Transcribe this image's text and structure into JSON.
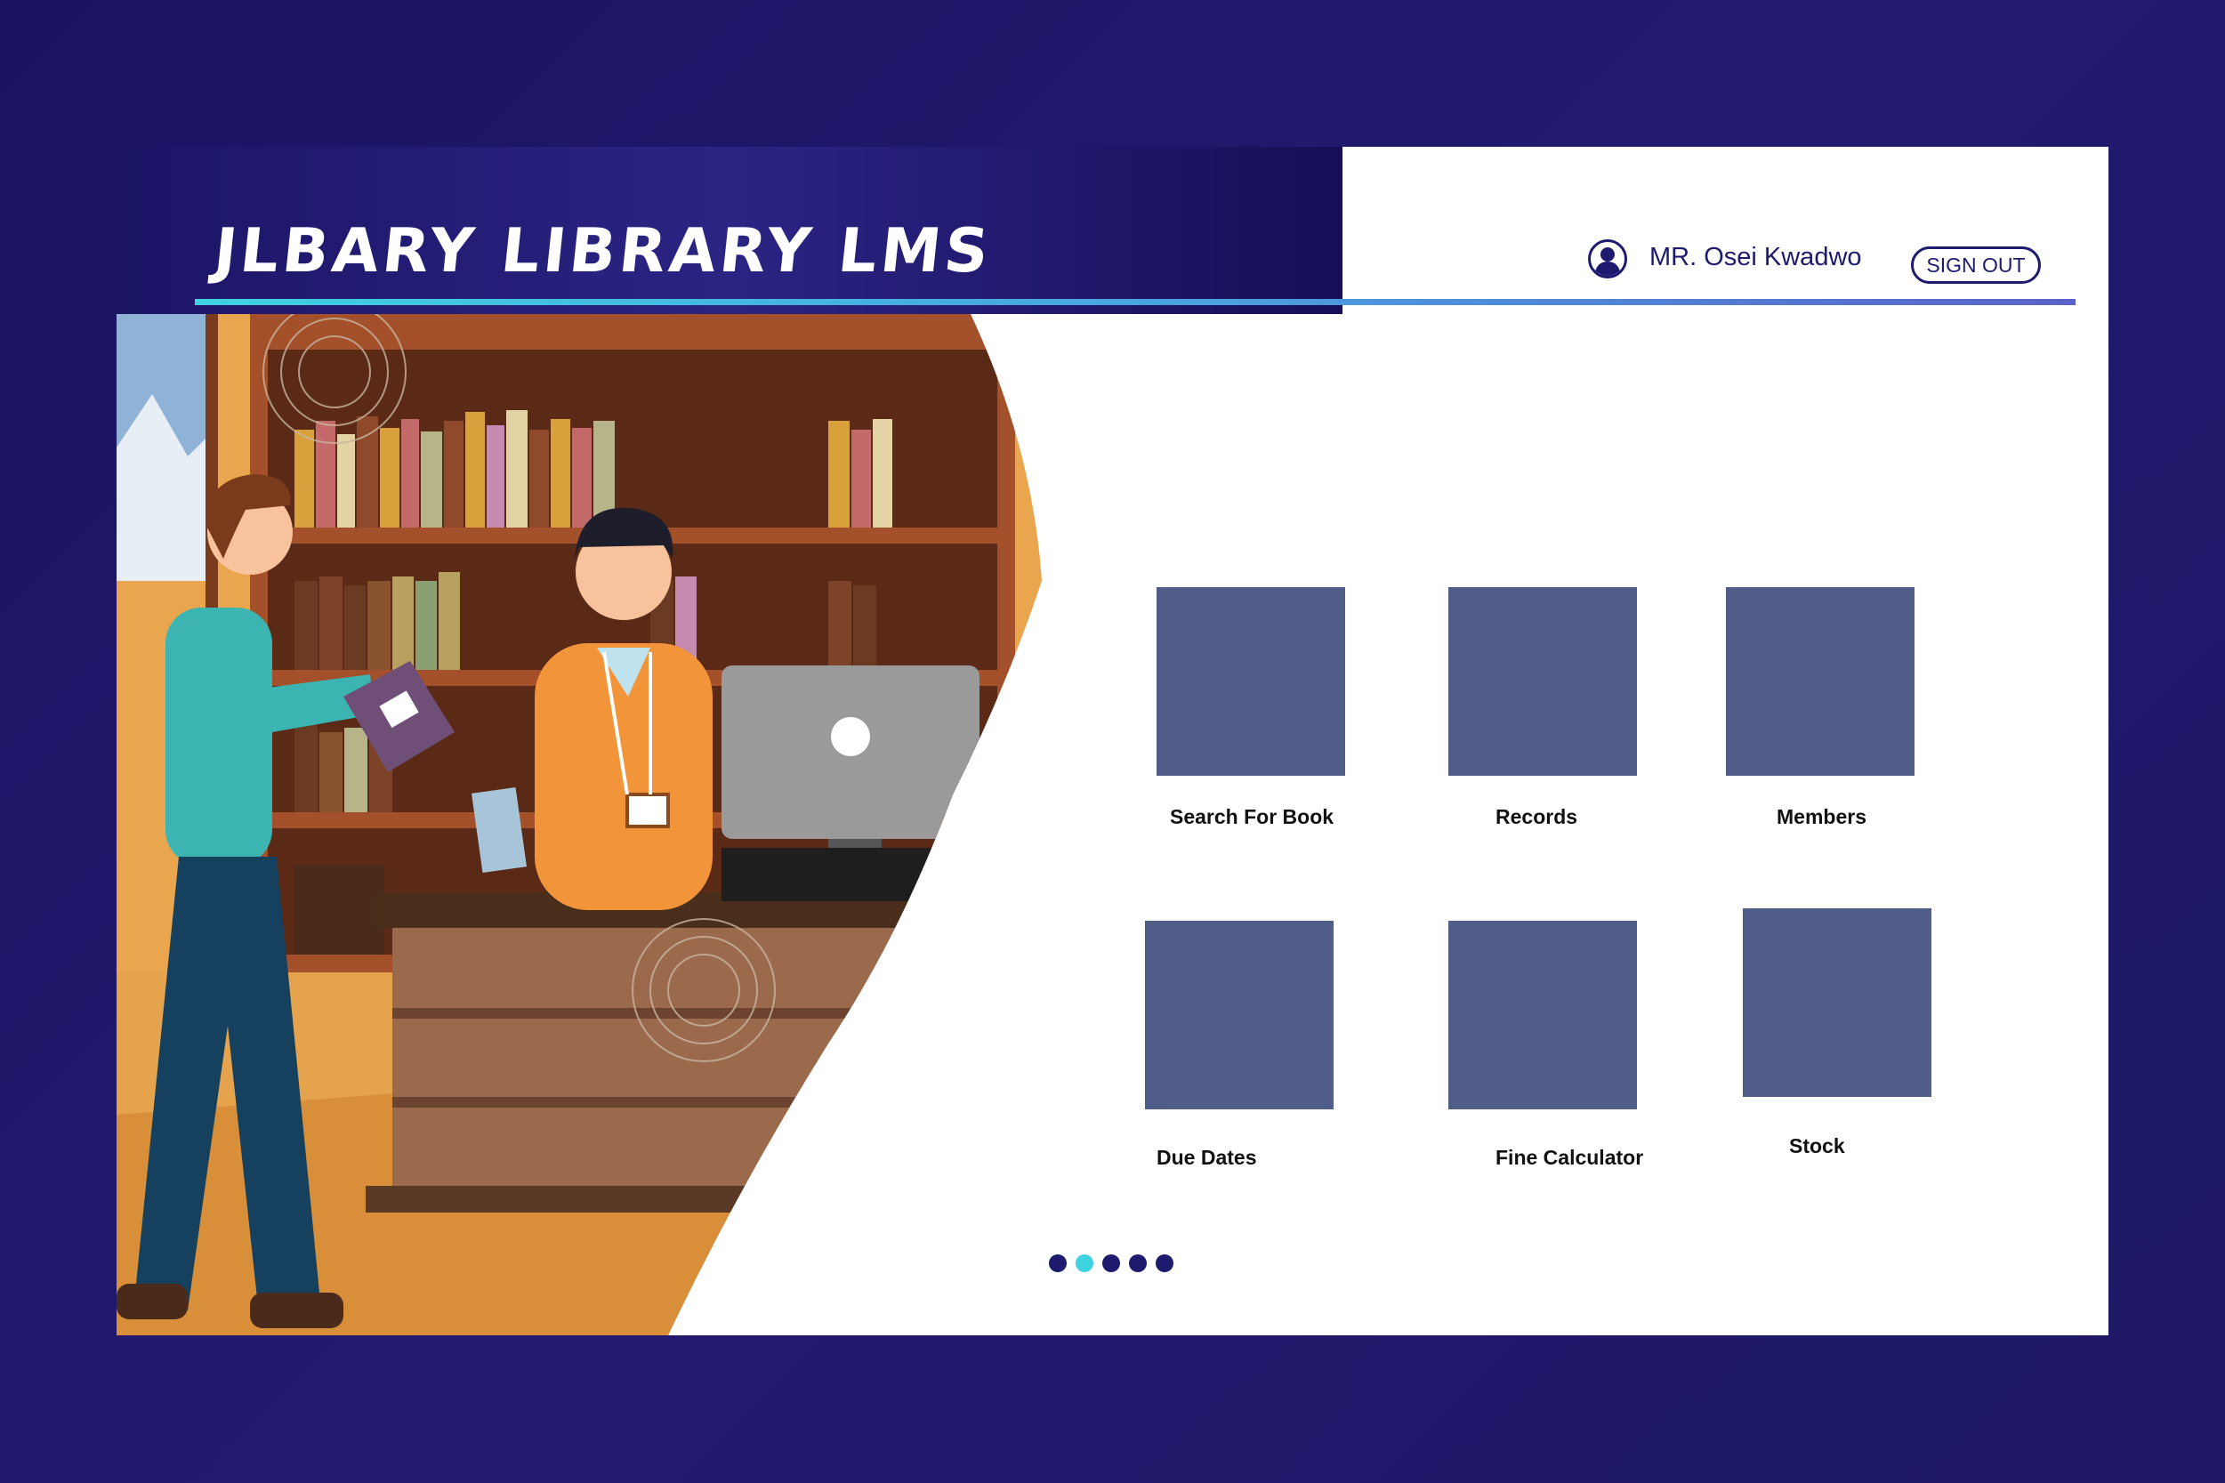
{
  "app": {
    "title": "JLBARY LIBRARY LMS"
  },
  "user": {
    "name": "MR. Osei Kwadwo",
    "icon": "user-icon"
  },
  "actions": {
    "signout_label": "SIGN OUT"
  },
  "tiles": [
    {
      "label": "Search For Book"
    },
    {
      "label": "Records"
    },
    {
      "label": "Members"
    },
    {
      "label": "Due Dates"
    },
    {
      "label": "Fine Calculator"
    },
    {
      "label": "Stock"
    }
  ],
  "carousel": {
    "count": 5,
    "active_index": 1
  },
  "colors": {
    "background": "#1e166a",
    "tile": "#4f5d88",
    "accent": "#3fd2e0",
    "text_dark": "#1e1a6e"
  }
}
